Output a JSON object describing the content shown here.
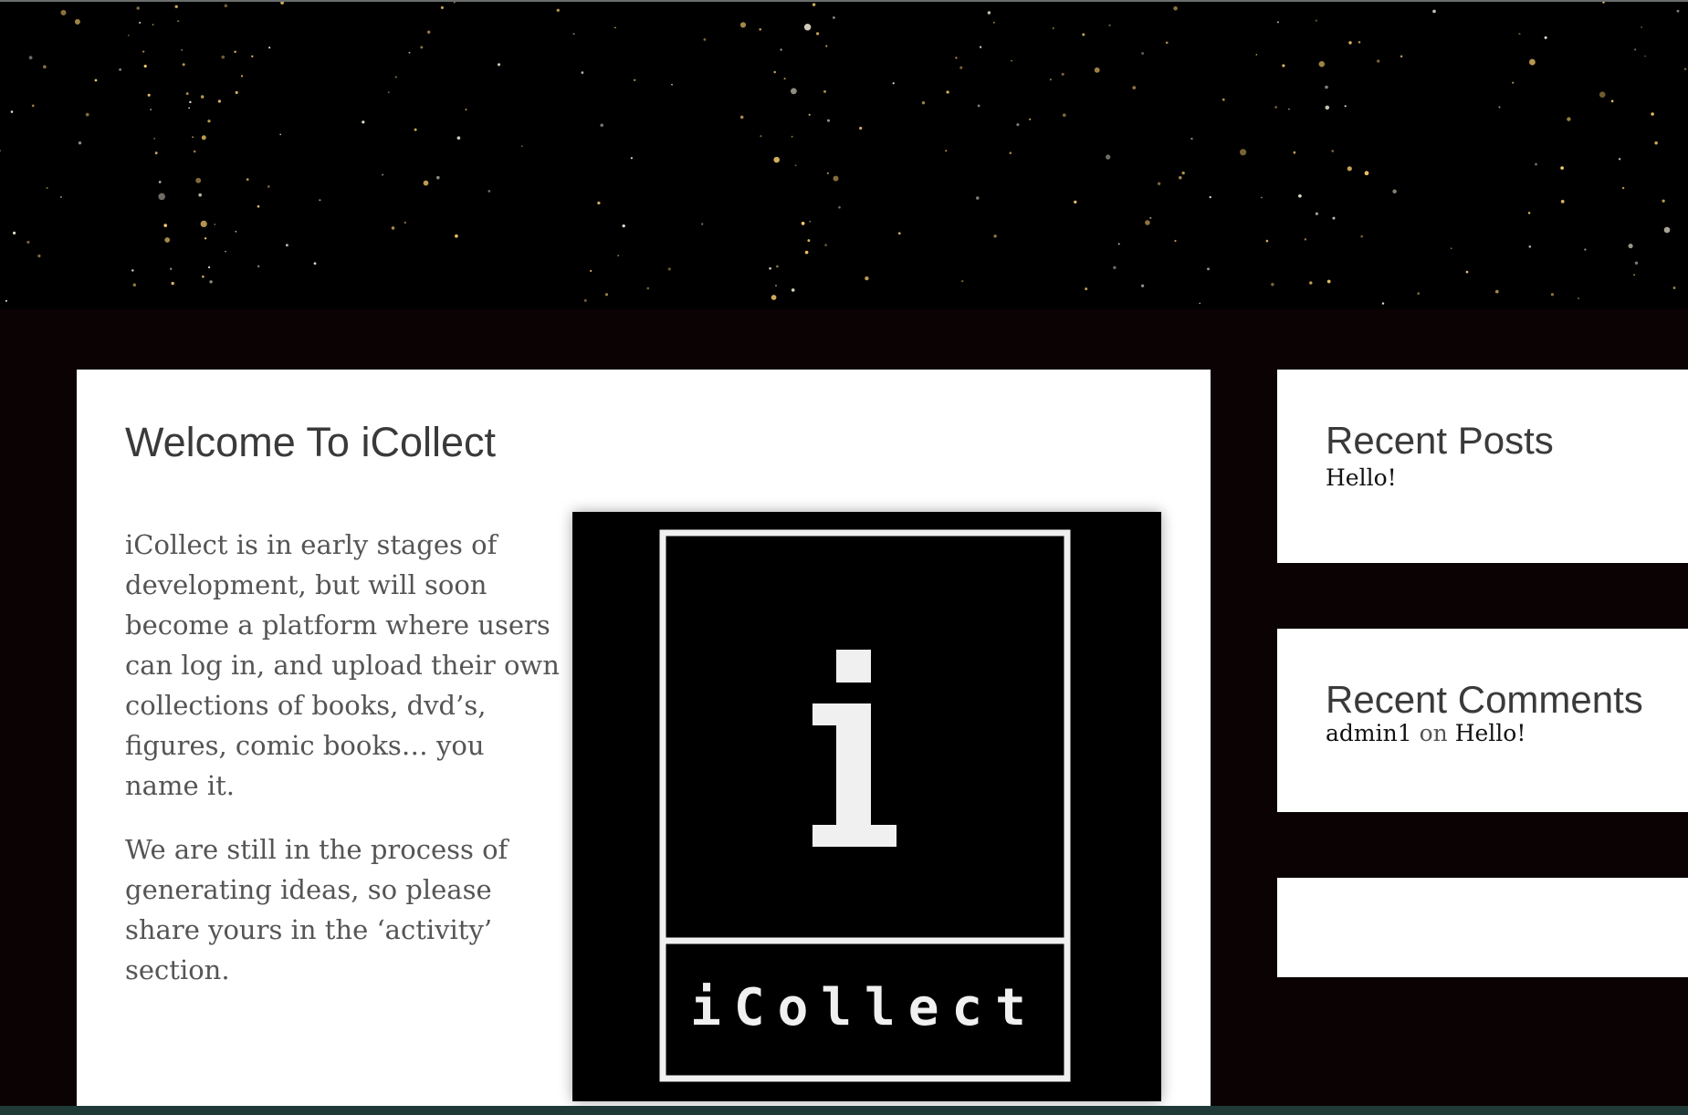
{
  "main": {
    "title": "Welcome To iCollect",
    "paragraphs": [
      "iCollect is in early stages of development, but will soon become a platform where users can log in, and upload their own collections of books, dvd’s, figures, comic books… you name it.",
      "We are still in the process of generating ideas, so please share yours in the ‘activity’ section."
    ],
    "logo": {
      "letter": "i",
      "word": "iCollect"
    }
  },
  "sidebar": {
    "recent_posts": {
      "title": "Recent Posts",
      "items": [
        "Hello!"
      ]
    },
    "recent_comments": {
      "title": "Recent Comments",
      "author": "admin1",
      "connector": "on",
      "post": "Hello!"
    }
  },
  "colors": {
    "page_background": "#0b0203",
    "card_background": "#ffffff",
    "heading_text": "#3a3a3a",
    "body_text": "#555555",
    "star_gold": "#f5c96b",
    "bottom_strip": "#1f3a36"
  },
  "icons": {
    "header": "starfield-banner",
    "logo": "icollect-logo"
  }
}
